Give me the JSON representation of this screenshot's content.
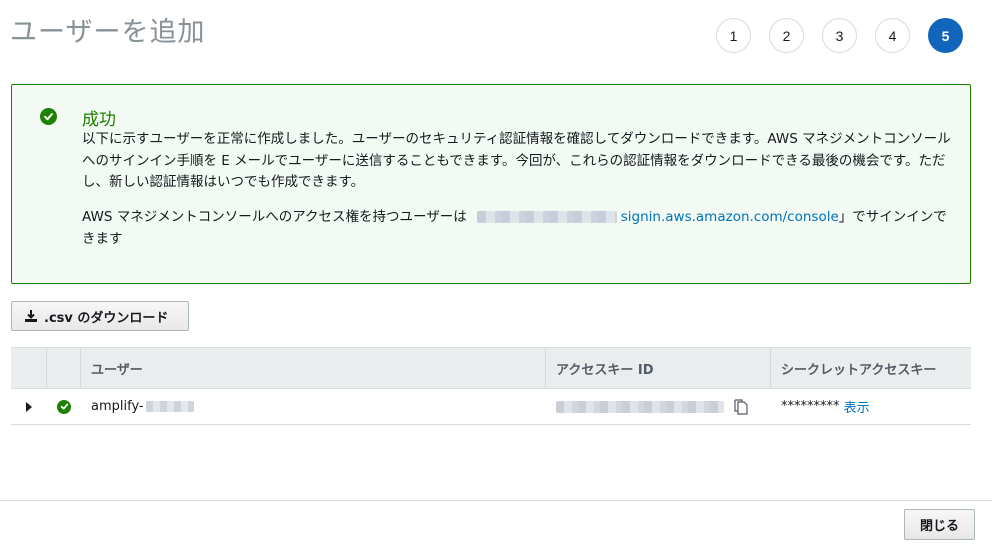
{
  "page": {
    "title": "ユーザーを追加"
  },
  "steps": {
    "labels": [
      "1",
      "2",
      "3",
      "4",
      "5"
    ],
    "active": "5"
  },
  "alert": {
    "title": "成功",
    "body": "以下に示すユーザーを正常に作成しました。ユーザーのセキュリティ認証情報を確認してダウンロードできます。AWS マネジメントコンソールへのサインイン手順を E メールでユーザーに送信することもできます。今回が、これらの認証情報をダウンロードできる最後の機会です。ただし、新しい認証情報はいつでも作成できます。",
    "console_prefix": "AWS マネジメントコンソールへのアクセス権を持つユーザーは",
    "console_link": "signin.aws.amazon.com/console",
    "console_suffix": "」でサインインできます",
    "icon": "check-circle-icon",
    "color": "#1d8102"
  },
  "download_button": {
    "label": ".csv のダウンロード",
    "icon": "download-icon"
  },
  "table": {
    "headers": {
      "user": "ユーザー",
      "access_key_id": "アクセスキー ID",
      "secret_key": "シークレットアクセスキー"
    },
    "rows": [
      {
        "user": "amplify-",
        "secret_masked": "*********",
        "show_label": "表示"
      }
    ]
  },
  "footer": {
    "close_label": "閉じる"
  },
  "colors": {
    "accent": "#1166bb",
    "success": "#1d8102",
    "link": "#0073bb"
  }
}
